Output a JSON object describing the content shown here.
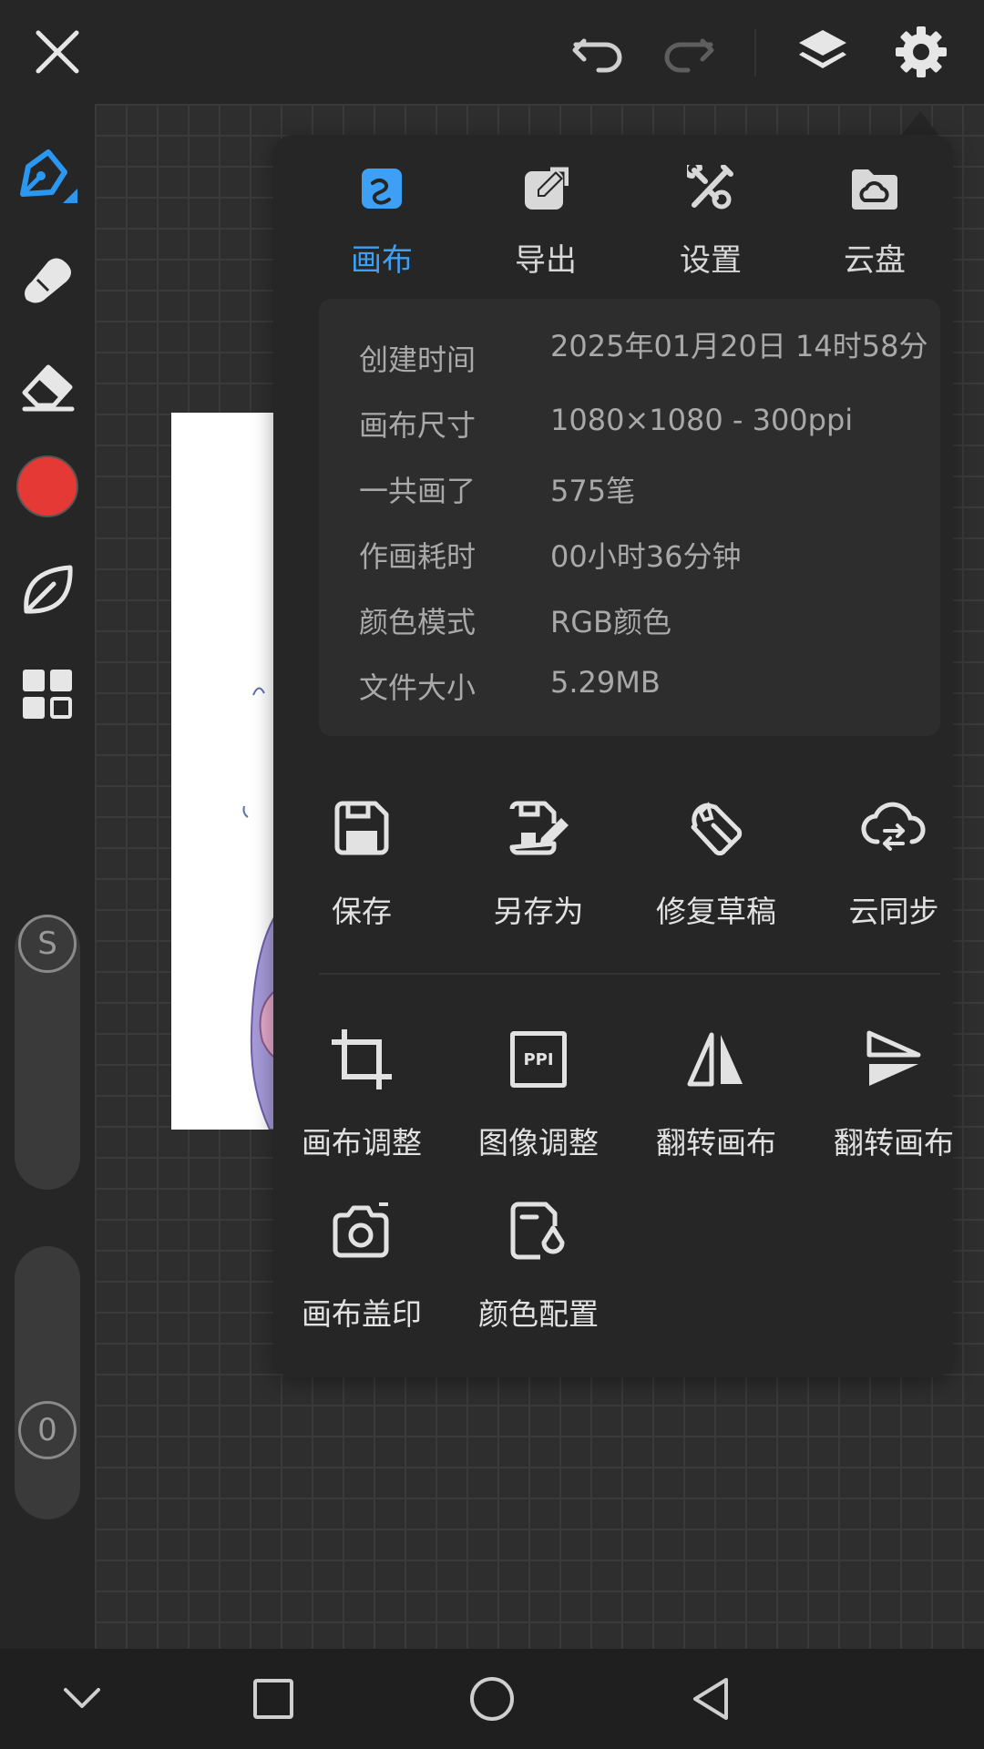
{
  "topbar": {
    "close_icon": "close-icon",
    "undo_icon": "undo-icon",
    "redo_icon": "redo-icon",
    "layers_icon": "layers-icon",
    "settings_icon": "gear-icon"
  },
  "toolbar": {
    "tools": [
      "pen-icon",
      "smudge-icon",
      "eraser-icon",
      "color-swatch",
      "leaf-icon",
      "grid-icon"
    ],
    "color": "#e53935",
    "accent": "#2a98f0",
    "size_knob": "S",
    "opacity_knob": "0"
  },
  "panel": {
    "tabs": [
      {
        "label": "画布",
        "icon": "canvas-icon",
        "active": true
      },
      {
        "label": "导出",
        "icon": "export-icon",
        "active": false
      },
      {
        "label": "设置",
        "icon": "tools-icon",
        "active": false
      },
      {
        "label": "云盘",
        "icon": "cloud-folder-icon",
        "active": false
      }
    ],
    "info": [
      {
        "label": "创建时间",
        "value": "2025年01月20日 14时58分"
      },
      {
        "label": "画布尺寸",
        "value": "1080×1080 - 300ppi"
      },
      {
        "label": "一共画了",
        "value": "575笔"
      },
      {
        "label": "作画耗时",
        "value": "00小时36分钟"
      },
      {
        "label": "颜色模式",
        "value": "RGB颜色"
      },
      {
        "label": "文件大小",
        "value": "5.29MB"
      }
    ],
    "actions_row1": [
      {
        "label": "保存",
        "icon": "save-icon"
      },
      {
        "label": "另存为",
        "icon": "save-as-icon"
      },
      {
        "label": "修复草稿",
        "icon": "wrench-icon"
      },
      {
        "label": "云同步",
        "icon": "cloud-sync-icon"
      }
    ],
    "actions_row2": [
      {
        "label": "画布调整",
        "icon": "crop-icon"
      },
      {
        "label": "图像调整",
        "icon": "ppi-icon"
      },
      {
        "label": "翻转画布",
        "icon": "flip-horizontal-icon"
      },
      {
        "label": "翻转画布",
        "icon": "flip-vertical-icon"
      }
    ],
    "actions_row3": [
      {
        "label": "画布盖印",
        "icon": "camera-icon"
      },
      {
        "label": "颜色配置",
        "icon": "color-profile-icon"
      }
    ],
    "ppi_text": "PPI"
  },
  "navbar": {
    "items": [
      "chevron-down-icon",
      "recent-apps-icon",
      "home-icon",
      "back-icon"
    ]
  }
}
